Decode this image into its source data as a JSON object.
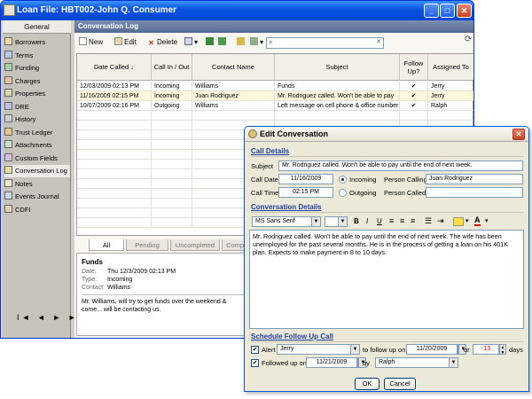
{
  "window": {
    "title": "Loan File: HBT002-John Q. Consumer"
  },
  "sidebar": {
    "header": "General",
    "items": [
      {
        "label": "Borrowers"
      },
      {
        "label": "Terms"
      },
      {
        "label": "Funding"
      },
      {
        "label": "Charges"
      },
      {
        "label": "Properties"
      },
      {
        "label": "DRE"
      },
      {
        "label": "History"
      },
      {
        "label": "Trust Ledger"
      },
      {
        "label": "Attachments"
      },
      {
        "label": "Custom Fields"
      },
      {
        "label": "Conversation Log"
      },
      {
        "label": "Notes"
      },
      {
        "label": "Events Journal"
      },
      {
        "label": "CDFI"
      }
    ],
    "active_index": 10,
    "nav": "I◄ ◄ ► ►I"
  },
  "content": {
    "header": "Conversation Log",
    "toolbar": {
      "new_label": "New",
      "edit_label": "Edit",
      "delete_label": "Delete",
      "search_value": ""
    },
    "columns": [
      "Date Called ↓",
      "Call In / Out",
      "Contact Name",
      "Subject",
      "Follow Up?",
      "Assigned To"
    ],
    "rows": [
      {
        "date": "12/03/2009 02:13 PM",
        "inout": "Incoming",
        "contact": "Williams",
        "subject": "Funds",
        "follow": "✔",
        "assigned": "Jerry"
      },
      {
        "date": "11/16/2009 02:15 PM",
        "inout": "Incoming",
        "contact": "Juan Rodriguez",
        "subject": "Mr. Rodriguez called. Won't be able to pay",
        "follow": "✔",
        "assigned": "Jerry"
      },
      {
        "date": "10/07/2009 02:16 PM",
        "inout": "Outgoing",
        "contact": "Williams",
        "subject": "Left message on cell phone & office number",
        "follow": "✔",
        "assigned": "Ralph"
      }
    ],
    "tabs": [
      "All",
      "Pending",
      "Uncompleted",
      "Comple"
    ],
    "detail": {
      "title": "Funds",
      "date_label": "Date:",
      "date_value": "Thu 12/3/2009 02:13 PM",
      "type_label": "Type:",
      "type_value": "Incoming",
      "contact_label": "Contact:",
      "contact_value": "Williams",
      "body": "Mr. Williams, will try to get funds over the weekend & come... will be contacting us."
    }
  },
  "dialog": {
    "title": "Edit Conversation",
    "call_details_title": "Call Details",
    "subject_label": "Subject",
    "subject_value": "Mr. Rodriguez called. Won't be able to pay until the end of next week.",
    "call_date_label": "Call Date",
    "call_date_value": "11/16/2009",
    "call_time_label": "Call Time",
    "call_time_value": "02:15 PM",
    "incoming_label": "Incoming",
    "outgoing_label": "Outgoing",
    "person_calling_label": "Person Calling",
    "person_calling_value": "Juan Rodriguez",
    "person_called_label": "Person Called",
    "person_called_value": "",
    "conversation_title": "Conversation Details",
    "font_value": "MS Sans Serif",
    "size_value": "",
    "bold": "B",
    "italic": "I",
    "underline": "U",
    "conversation_text": "Mr. Rodriguez called. Won't be able to pay until the end of next week. The wife has been unemployed for the past several months. He is in the process of getting a loan on his 401K plan. Expects to make payment in 8 to 10 days.",
    "schedule_title": "Schedule Follow Up Call",
    "alert_label": "Alert",
    "alert_person": "Jerry",
    "follow_up_on_label": "to follow up on",
    "follow_up_date": "11/20/2009",
    "or_label": "or",
    "days_value": "-13",
    "days_label": "days",
    "followed_up_label": "Followed up on",
    "followed_up_date": "11/21/2009",
    "by_label": "by",
    "by_person": "Ralph",
    "ok_label": "OK",
    "cancel_label": "Cancel"
  }
}
